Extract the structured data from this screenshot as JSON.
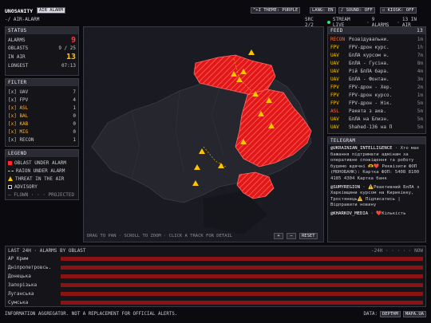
{
  "app": {
    "title": "UNOSANITY",
    "mode": "AIR ALARM",
    "breadcrumb": "-/ AIR-ALARM"
  },
  "top_controls": [
    {
      "label": "^+I THEME: PURPLE",
      "active": false
    },
    {
      "label": "LANG: EN",
      "active": false
    },
    {
      "label": "♪ SOUND: OFF",
      "active": false
    },
    {
      "label": "☐ KIOSK: OFF",
      "active": false
    }
  ],
  "status_line": {
    "src": "SRC 2/2",
    "stream": "STREAM LIVE",
    "alarms": "9 ALARMS",
    "in_air": "13 IN AIR"
  },
  "status": {
    "title": "STATUS",
    "rows": [
      {
        "label": "ALARMS",
        "value": "9"
      },
      {
        "label": "OBLASTS",
        "value": "9 / 25"
      },
      {
        "label": "IN AIR",
        "value": "13"
      },
      {
        "label": "LONGEST",
        "value": "07:13"
      }
    ]
  },
  "filter": {
    "title": "FILTER",
    "items": [
      {
        "label": "[x] UAV",
        "count": "7"
      },
      {
        "label": "[x] FPV",
        "count": "4"
      },
      {
        "label": "[x] ASL",
        "count": "1"
      },
      {
        "label": "[x] BAL",
        "count": "0"
      },
      {
        "label": "[x] KAB",
        "count": "0"
      },
      {
        "label": "[x] MIG",
        "count": "0"
      },
      {
        "label": "[x] RECON",
        "count": "1"
      }
    ]
  },
  "legend": {
    "title": "LEGEND",
    "items": [
      {
        "label": "OBLAST UNDER ALARM",
        "color": "#ff2a2a"
      },
      {
        "label": "RAION UNDER ALARM",
        "color": "#c9c9d2"
      },
      {
        "label": "THREAT IN THE AIR",
        "color": "#ffc400"
      },
      {
        "label": "ADVISORY",
        "color": "#c9c9d2"
      },
      {
        "label": "— FLOWN · · · PROJECTED",
        "color": "#8c8c98"
      }
    ]
  },
  "map": {
    "hint": "DRAG TO PAN · SCROLL TO ZOOM · CLICK A TRACK FOR DETAIL",
    "zoom_in": "+",
    "zoom_out": "−",
    "reset": "RESET"
  },
  "feed": {
    "title": "FEED",
    "count": "13",
    "items": [
      {
        "tag": "RECON",
        "text": "Розвідувальни.",
        "time": "1m"
      },
      {
        "tag": "FPV",
        "text": "FPV-дрон курс.",
        "time": "1h"
      },
      {
        "tag": "UAV",
        "text": "БпЛА курсом н.",
        "time": "7m"
      },
      {
        "tag": "UAV",
        "text": "БпЛА - Гусіна.",
        "time": "8m"
      },
      {
        "tag": "UAV",
        "text": "Рій БпЛА бара.",
        "time": "4m"
      },
      {
        "tag": "UAV",
        "text": "БпЛА - Фонтан.",
        "time": "3m"
      },
      {
        "tag": "FPV",
        "text": "FPV-дрон - Хер.",
        "time": "2m"
      },
      {
        "tag": "FPV",
        "text": "FPV-дрон курсо.",
        "time": "1m"
      },
      {
        "tag": "FPV",
        "text": "FPV-дрон - Нік.",
        "time": "5m"
      },
      {
        "tag": "ASL",
        "text": "Ракета з акв.",
        "time": "5m"
      },
      {
        "tag": "UAV",
        "text": "БпЛА на Близн.",
        "time": "5m"
      },
      {
        "tag": "UAV",
        "text": "Shahed-136 на П",
        "time": "5m"
      }
    ]
  },
  "telegram": {
    "title": "TELEGRAM",
    "posts": [
      {
        "channel": "@UKRAINIAN_INTELLIGENCE",
        "text": "· Хто має бажання підтримати адмінам за оперативне сповіщення та роботу будемо вдячні 🫶❤️ Реквізити ФОП (МОНОБАНК): Картка ФОП: 5408 8100 4185 4304 Картка банк"
      },
      {
        "channel": "@SUMYREGION",
        "text": "· ⚠️Реактивний БпЛА з Харківщини курсом на Кириківку, Тростянець⚠️ Підписатись | Відправити новину"
      },
      {
        "channel": "@KHARKOV_MEDIA",
        "text": "· ❤️Кількість"
      }
    ]
  },
  "timeline": {
    "title": "LAST 24H · ALARMS BY OBLAST",
    "range": "-24H · · · · · NOW",
    "rows": [
      {
        "label": "АР Крим",
        "fill": 1.0
      },
      {
        "label": "Дніпропетровсь.",
        "fill": 1.0
      },
      {
        "label": "Донецька",
        "fill": 1.0
      },
      {
        "label": "Запорізька",
        "fill": 1.0
      },
      {
        "label": "Луганська",
        "fill": 1.0
      },
      {
        "label": "Сумська",
        "fill": 1.0
      }
    ]
  },
  "footer": {
    "disclaimer": "INFORMATION AGGREGATOR. NOT A REPLACEMENT FOR OFFICIAL ALERTS.",
    "data_label": "DATA:",
    "sources": [
      "DEPTHM",
      "MAPA.UA"
    ]
  },
  "colors": {
    "alarm": "#ff2a2a",
    "threat": "#ffc400",
    "panel": "#141419",
    "bg": "#0b0b0f"
  }
}
